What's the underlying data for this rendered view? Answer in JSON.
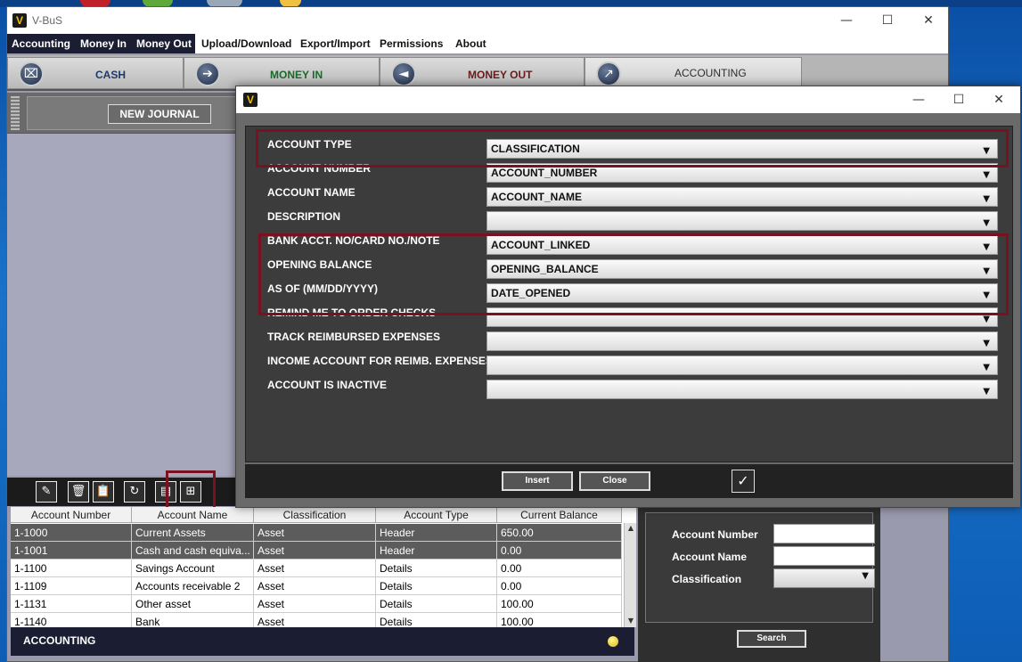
{
  "app": {
    "title": "V-BuS",
    "logo_letter": "V"
  },
  "window_controls": {
    "minimize": "—",
    "maximize": "☐",
    "close": "✕"
  },
  "menu": [
    "Accounting",
    "Money In",
    "Money Out",
    "Upload/Download",
    "Export/Import",
    "Permissions",
    "About"
  ],
  "tabs": [
    {
      "label": "CASH",
      "color": "#1b3a6b"
    },
    {
      "label": "MONEY IN",
      "color": "#1a6a2a"
    },
    {
      "label": "MONEY OUT",
      "color": "#6a1b1b"
    },
    {
      "label": "ACCOUNTING",
      "color": "#2d2d2d"
    }
  ],
  "left": {
    "new_journal": "NEW JOURNAL"
  },
  "table": {
    "columns": [
      "Account Number",
      "Account Name",
      "Classification",
      "Account Type",
      "Current Balance"
    ],
    "rows": [
      [
        "1-1000",
        "Current Assets",
        "Asset",
        "Header",
        "650.00"
      ],
      [
        "1-1001",
        "Cash and cash equiva...",
        "Asset",
        "Header",
        "0.00"
      ],
      [
        "1-1100",
        "Savings Account",
        "Asset",
        "Details",
        "0.00"
      ],
      [
        "1-1109",
        "Accounts receivable 2",
        "Asset",
        "Details",
        "0.00"
      ],
      [
        "1-1131",
        "Other asset",
        "Asset",
        "Details",
        "100.00"
      ],
      [
        "1-1140",
        "Bank",
        "Asset",
        "Details",
        "100.00"
      ]
    ]
  },
  "status": {
    "text": "ACCOUNTING"
  },
  "search": {
    "account_number_label": "Account Number",
    "account_name_label": "Account Name",
    "classification_label": "Classification",
    "button": "Search"
  },
  "dialog": {
    "logo_letter": "V",
    "fields": [
      {
        "label": "ACCOUNT TYPE",
        "value": "CLASSIFICATION"
      },
      {
        "label": "ACCOUNT NUMBER",
        "value": "ACCOUNT_NUMBER"
      },
      {
        "label": "ACCOUNT NAME",
        "value": "ACCOUNT_NAME"
      },
      {
        "label": "DESCRIPTION",
        "value": ""
      },
      {
        "label": "BANK ACCT. NO/CARD NO./NOTE",
        "value": "ACCOUNT_LINKED"
      },
      {
        "label": "OPENING BALANCE",
        "value": "OPENING_BALANCE"
      },
      {
        "label": "AS OF (MM/DD/YYYY)",
        "value": "DATE_OPENED"
      },
      {
        "label": "REMIND ME TO ORDER CHECKS",
        "value": ""
      },
      {
        "label": "TRACK REIMBURSED EXPENSES",
        "value": ""
      },
      {
        "label": "INCOME ACCOUNT FOR REIMB. EXPENSES",
        "value": ""
      },
      {
        "label": "ACCOUNT IS INACTIVE",
        "value": ""
      }
    ],
    "insert": "Insert",
    "close": "Close",
    "confirm_icon": "✓"
  },
  "colors": {
    "highlight": "#7b1020",
    "dark_bar": "#1b1e33"
  }
}
